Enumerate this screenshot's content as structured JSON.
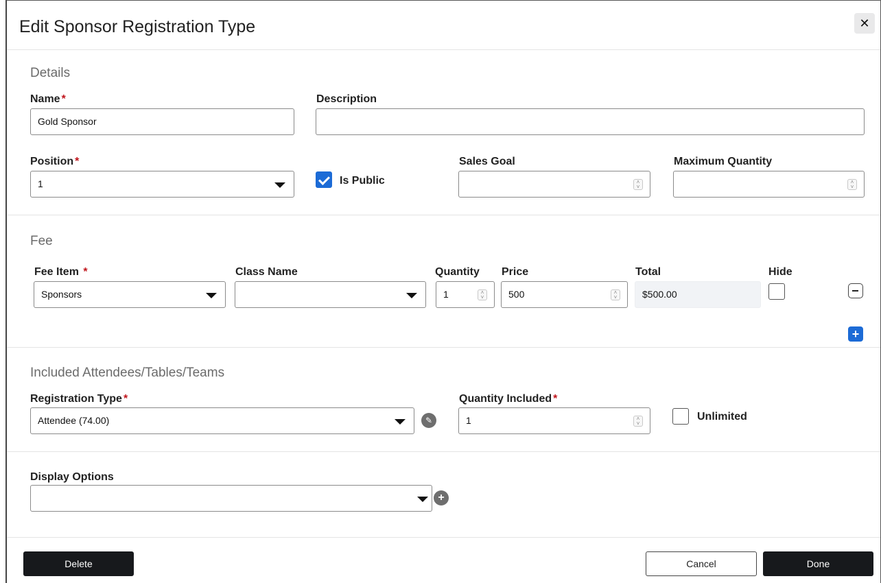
{
  "dialog": {
    "title": "Edit Sponsor Registration Type",
    "close_label": "✕"
  },
  "details": {
    "section_title": "Details",
    "name_label": "Name",
    "name_value": "Gold Sponsor",
    "description_label": "Description",
    "description_value": "",
    "position_label": "Position",
    "position_value": "1",
    "is_public_label": "Is Public",
    "is_public_checked": true,
    "sales_goal_label": "Sales Goal",
    "sales_goal_value": "",
    "max_quantity_label": "Maximum Quantity",
    "max_quantity_value": ""
  },
  "fee": {
    "section_title": "Fee",
    "fee_item_label": "Fee Item",
    "fee_item_value": "Sponsors",
    "class_name_label": "Class Name",
    "class_name_value": "",
    "quantity_label": "Quantity",
    "quantity_value": "1",
    "price_label": "Price",
    "price_value": "500",
    "total_label": "Total",
    "total_value": "$500.00",
    "hide_label": "Hide",
    "add_icon": "+"
  },
  "included": {
    "section_title": "Included Attendees/Tables/Teams",
    "registration_type_label": "Registration Type",
    "registration_type_value": "Attendee (74.00)",
    "quantity_included_label": "Quantity Included",
    "quantity_included_value": "1",
    "unlimited_label": "Unlimited"
  },
  "display_options": {
    "label": "Display Options",
    "value": "",
    "add_icon": "+"
  },
  "footer": {
    "delete_label": "Delete",
    "cancel_label": "Cancel",
    "done_label": "Done"
  },
  "required_marker": "*",
  "colors": {
    "accent": "#1c6bd6",
    "required": "#c0141b",
    "dark_button": "#17191c"
  }
}
